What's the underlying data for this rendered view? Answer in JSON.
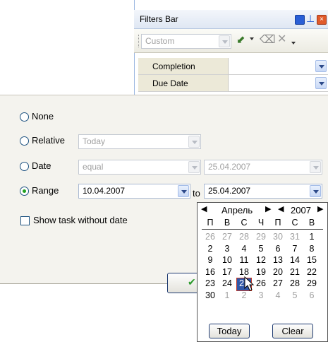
{
  "filters_bar": {
    "title": "Filters Bar",
    "preset": "Custom"
  },
  "grid": {
    "rows": [
      {
        "label": "Completion"
      },
      {
        "label": "Due Date"
      }
    ]
  },
  "options": {
    "none_label": "None",
    "relative_label": "Relative",
    "relative_value": "Today",
    "date_label": "Date",
    "date_op": "equal",
    "date_value": "25.04.2007",
    "range_label": "Range",
    "range_from": "10.04.2007",
    "range_to_label": "to",
    "range_to": "25.04.2007",
    "show_without_date": "Show task without date"
  },
  "calendar": {
    "month": "Апрель",
    "year": "2007",
    "weekdays": [
      "П",
      "В",
      "С",
      "Ч",
      "П",
      "С",
      "В"
    ],
    "weeks": [
      [
        "26",
        "27",
        "28",
        "29",
        "30",
        "31",
        "1"
      ],
      [
        "2",
        "3",
        "4",
        "5",
        "6",
        "7",
        "8"
      ],
      [
        "9",
        "10",
        "11",
        "12",
        "13",
        "14",
        "15"
      ],
      [
        "16",
        "17",
        "18",
        "19",
        "20",
        "21",
        "22"
      ],
      [
        "23",
        "24",
        "25",
        "26",
        "27",
        "28",
        "29"
      ],
      [
        "30",
        "1",
        "2",
        "3",
        "4",
        "5",
        "6"
      ]
    ],
    "selected": "25",
    "today_label": "Today",
    "clear_label": "Clear"
  }
}
